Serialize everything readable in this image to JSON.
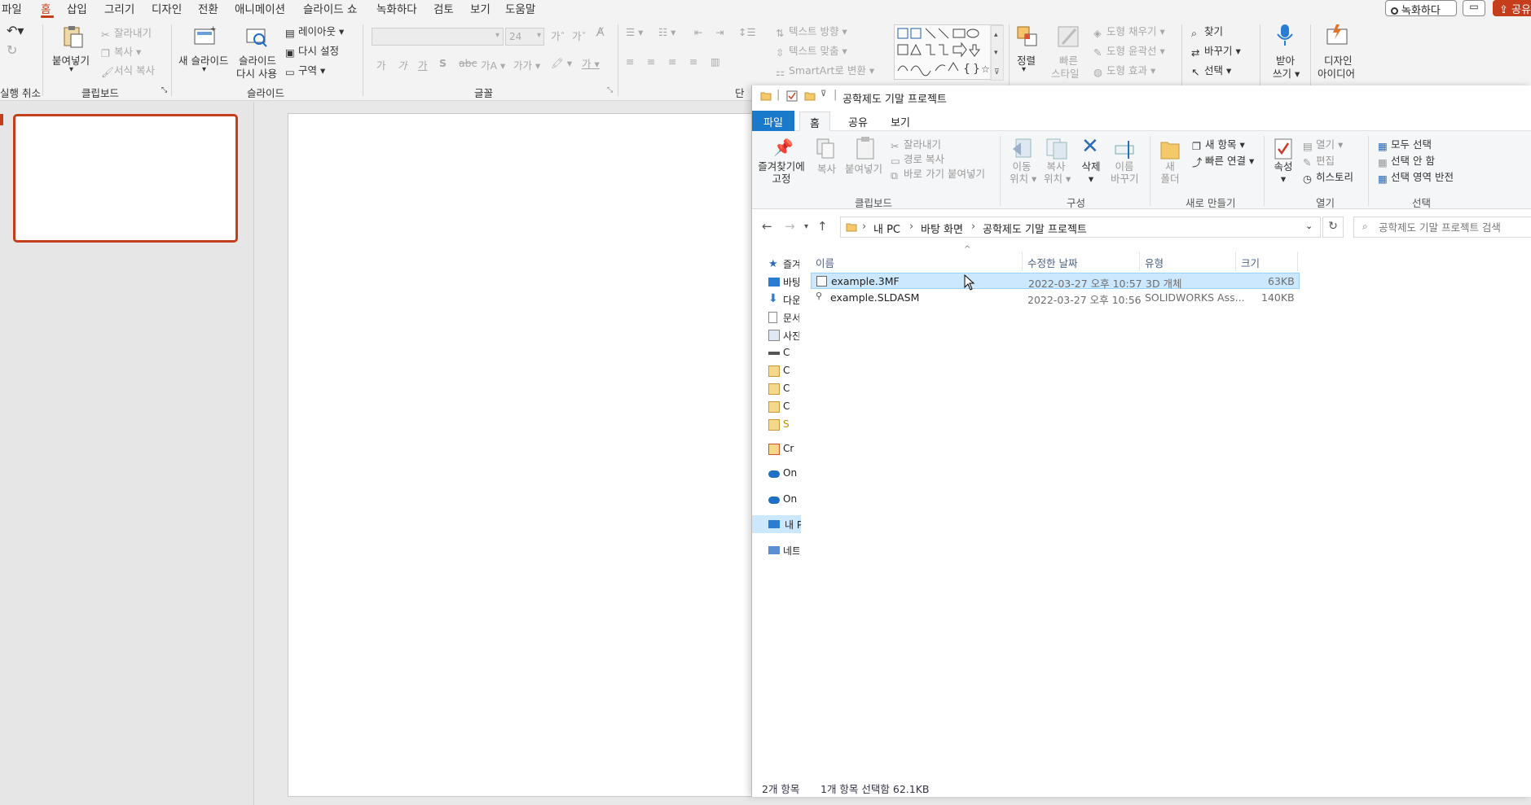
{
  "ppt": {
    "menu": [
      "파일",
      "홈",
      "삽입",
      "그리기",
      "디자인",
      "전환",
      "애니메이션",
      "슬라이드 쇼",
      "녹화하다",
      "검토",
      "보기",
      "도움말"
    ],
    "record_label": "녹화하다",
    "share_label": "공유",
    "ribbon": {
      "undo_group": "실행 취소",
      "paste": "붙여넣기",
      "cut": "잘라내기",
      "copy": "복사",
      "format_painter": "서식 복사",
      "clipboard_group": "클립보드",
      "new_slide": "새 슬라이드",
      "reuse_slide_1": "슬라이드",
      "reuse_slide_2": "다시 사용",
      "layout": "레이아웃",
      "reset": "다시 설정",
      "section": "구역",
      "slides_group": "슬라이드",
      "font_size": "24",
      "font_group": "글꼴",
      "paragraph_group_partial": "단",
      "text_direction": "텍스트 방향",
      "align_text": "텍스트 맞춤",
      "smartart": "SmartArt로 변환",
      "arrange": "정렬",
      "quick_styles_1": "빠른",
      "quick_styles_2": "스타일",
      "shape_fill": "도형 채우기",
      "shape_outline": "도형 윤곽선",
      "shape_effects": "도형 효과",
      "find": "찾기",
      "replace": "바꾸기",
      "select": "선택",
      "dictate_1": "받아",
      "dictate_2": "쓰기",
      "designer_1": "디자인",
      "designer_2": "아이디어"
    }
  },
  "explorer": {
    "title": "공학제도 기말 프로젝트",
    "tabs": [
      "파일",
      "홈",
      "공유",
      "보기"
    ],
    "ribbon": {
      "pin_1": "즐겨찾기에",
      "pin_2": "고정",
      "copy": "복사",
      "paste": "붙여넣기",
      "cut": "잘라내기",
      "copy_path": "경로 복사",
      "paste_shortcut": "바로 가기 붙여넣기",
      "clipboard_group": "클립보드",
      "move_to_1": "이동",
      "move_to_2": "위치",
      "copy_to_1": "복사",
      "copy_to_2": "위치",
      "delete": "삭제",
      "rename_1": "이름",
      "rename_2": "바꾸기",
      "organize_group": "구성",
      "new_folder_1": "새",
      "new_folder_2": "폴더",
      "new_item": "새 항목",
      "easy_access": "빠른 연결",
      "new_group": "새로 만들기",
      "properties": "속성",
      "open": "열기",
      "edit": "편집",
      "history": "히스토리",
      "open_group": "열기",
      "select_all": "모두 선택",
      "select_none": "선택 안 함",
      "invert_selection": "선택 영역 반전",
      "select_group": "선택"
    },
    "breadcrumb": [
      "내 PC",
      "바탕 화면",
      "공학제도 기말 프로젝트"
    ],
    "search_placeholder": "공학제도 기말 프로젝트 검색",
    "nav": [
      {
        "label": "즐겨찾기",
        "icon": "star-icon"
      },
      {
        "label": "바탕 화면",
        "icon": "desktop-icon"
      },
      {
        "label": "다운로드",
        "icon": "download-icon"
      },
      {
        "label": "문서",
        "icon": "document-icon"
      },
      {
        "label": "사진",
        "icon": "picture-icon"
      },
      {
        "label": "C",
        "icon": "drive-icon"
      },
      {
        "label": "C",
        "icon": "folder-icon"
      },
      {
        "label": "C",
        "icon": "folder-icon"
      },
      {
        "label": "C",
        "icon": "folder-icon"
      },
      {
        "label": "S",
        "icon": "folder-icon"
      },
      {
        "label": "Cr",
        "icon": "creative-cloud-icon"
      },
      {
        "label": "On",
        "icon": "onedrive-icon"
      },
      {
        "label": "On",
        "icon": "onedrive-icon"
      },
      {
        "label": "내 PC",
        "icon": "pc-icon"
      },
      {
        "label": "네트워크",
        "icon": "network-icon"
      }
    ],
    "columns": [
      "이름",
      "수정한 날짜",
      "유형",
      "크기"
    ],
    "files": [
      {
        "name": "example.3MF",
        "modified": "2022-03-27 오후 10:57",
        "type": "3D 개체",
        "size": "63KB",
        "selected": true
      },
      {
        "name": "example.SLDASM",
        "modified": "2022-03-27 오후 10:56",
        "type": "SOLIDWORKS Ass...",
        "size": "140KB",
        "selected": false
      }
    ],
    "status": {
      "count": "2개 항목",
      "selection": "1개 항목 선택함 62.1KB"
    }
  },
  "colors": {
    "accent": "#c43e1c",
    "explorer_blue": "#1979ca",
    "selection": "#cce8ff"
  }
}
